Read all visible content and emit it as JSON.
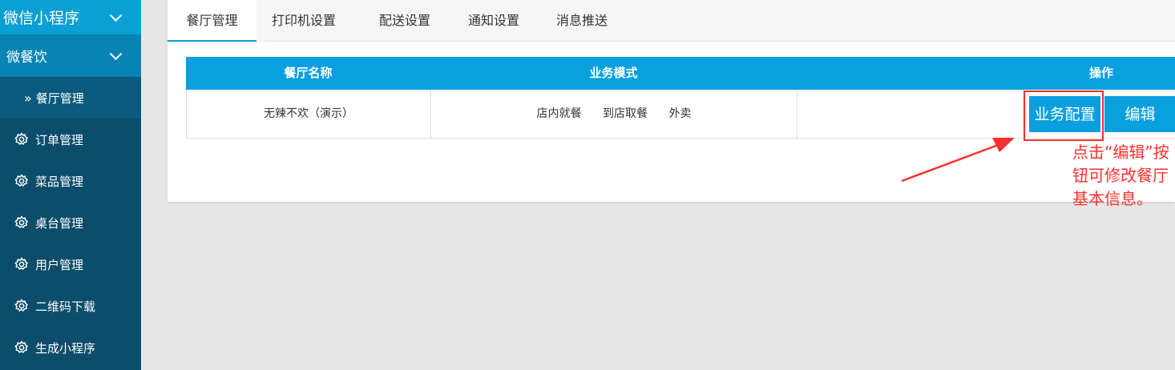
{
  "sidebar": {
    "header1": "微信小程序",
    "header2": "微餐饮",
    "sub_item": "餐厅管理",
    "items": [
      {
        "label": "订单管理"
      },
      {
        "label": "菜品管理"
      },
      {
        "label": "桌台管理"
      },
      {
        "label": "用户管理"
      },
      {
        "label": "二维码下载"
      },
      {
        "label": "生成小程序"
      }
    ]
  },
  "tabs": [
    {
      "label": "餐厅管理",
      "active": true
    },
    {
      "label": "打印机设置"
    },
    {
      "label": "配送设置"
    },
    {
      "label": "通知设置"
    },
    {
      "label": "消息推送"
    }
  ],
  "table": {
    "headers": [
      "餐厅名称",
      "业务模式",
      "操作"
    ],
    "rows": [
      {
        "name": "无辣不欢（演示）",
        "modes": [
          "店内就餐",
          "到店取餐",
          "外卖"
        ],
        "actions": [
          "业务配置",
          "编辑"
        ]
      }
    ]
  },
  "annotation": {
    "text": "点击“编辑”按钮可修改餐厅基本信息。",
    "color": "#ff3030"
  },
  "colors": {
    "sidebar_bg": "#0c4d6c",
    "accent": "#0aa0e0"
  }
}
